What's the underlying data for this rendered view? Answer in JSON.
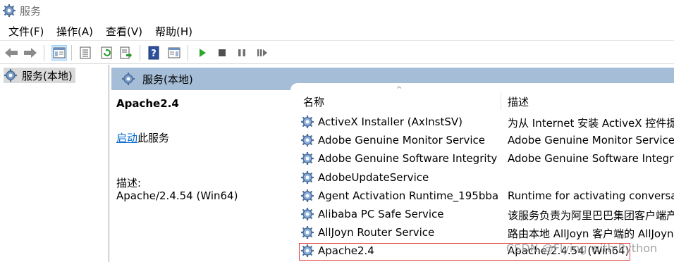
{
  "window": {
    "title": "服务"
  },
  "menubar": {
    "file": "文件(F)",
    "action": "操作(A)",
    "view": "查看(V)",
    "help": "帮助(H)"
  },
  "tree": {
    "root_label": "服务(本地)"
  },
  "pane": {
    "header": "服务(本地)"
  },
  "detail": {
    "service_name": "Apache2.4",
    "start_link": "启动",
    "start_suffix": "此服务",
    "description_label": "描述:",
    "description_value": "Apache/2.4.54 (Win64)"
  },
  "list": {
    "columns": {
      "name": "名称",
      "description": "描述"
    },
    "rows": [
      {
        "name": "ActiveX Installer (AxInstSV)",
        "description": "为从 Internet 安装 ActiveX 控件提供"
      },
      {
        "name": "Adobe Genuine Monitor Service",
        "description": "Adobe Genuine Monitor Service"
      },
      {
        "name": "Adobe Genuine Software Integrity S...",
        "description": "Adobe Genuine Software Integrity"
      },
      {
        "name": "AdobeUpdateService",
        "description": ""
      },
      {
        "name": "Agent Activation Runtime_195bba",
        "description": "Runtime for activating conversation"
      },
      {
        "name": "Alibaba PC Safe Service",
        "description": "该服务负责为阿里巴巴集团客户端产"
      },
      {
        "name": "AllJoyn Router Service",
        "description": "路由本地 AllJoyn 客户端的 AllJoyn 消"
      },
      {
        "name": "Apache2.4",
        "description": "Apache/2.4.54 (Win64)"
      }
    ]
  },
  "watermark": "CSDN @Flying with Python",
  "colors": {
    "pane_header": "#a5bdd6",
    "link": "#0066cc",
    "selection_border": "#dd4444",
    "play_green": "#2aa82a"
  }
}
